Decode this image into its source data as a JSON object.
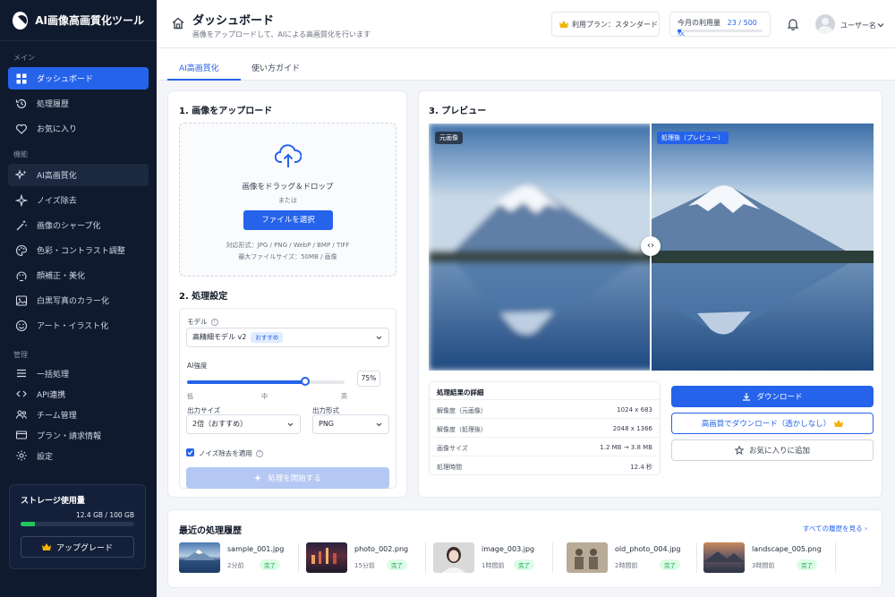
{
  "app": {
    "title": "AI画像高画質化ツール"
  },
  "sidebar": {
    "sections": [
      {
        "heading": "メイン",
        "items": [
          {
            "label": "ダッシュボード",
            "icon": "grid-icon",
            "active": true
          },
          {
            "label": "処理履歴",
            "icon": "history-icon"
          },
          {
            "label": "お気に入り",
            "icon": "heart-icon"
          }
        ]
      },
      {
        "heading": "機能",
        "items": [
          {
            "label": "AI高画質化",
            "icon": "sparkles-icon"
          },
          {
            "label": "ノイズ除去",
            "icon": "sparkle-small-icon"
          },
          {
            "label": "画像のシャープ化",
            "icon": "magic-wand-icon"
          },
          {
            "label": "色彩・コントラスト調整",
            "icon": "palette-icon"
          },
          {
            "label": "顔補正・美化",
            "icon": "face-icon"
          },
          {
            "label": "白黒写真のカラー化",
            "icon": "image-icon"
          },
          {
            "label": "アート・イラスト化",
            "icon": "smile-icon"
          }
        ]
      },
      {
        "heading": "管理",
        "items": [
          {
            "label": "一括処理",
            "icon": "list-icon"
          },
          {
            "label": "API連携",
            "icon": "api-icon"
          },
          {
            "label": "チーム管理",
            "icon": "team-icon"
          },
          {
            "label": "プラン・請求情報",
            "icon": "billing-icon"
          },
          {
            "label": "設定",
            "icon": "gear-icon"
          }
        ]
      }
    ],
    "storage": {
      "title": "ストレージ使用量",
      "value": "12.4 GB / 100 GB",
      "fraction": 0.124,
      "upgrade_label": "アップグレード"
    }
  },
  "header": {
    "title": "ダッシュボード",
    "subtitle": "画像をアップロードして、AIによる高画質化を行います",
    "plan": "利用プラン：スタンダード",
    "usage_label": "今月の利用量",
    "usage_count": "23 / 500 枚",
    "usage_fraction": 0.046,
    "username": "ユーザー名"
  },
  "tabs": [
    "AI高画質化",
    "使い方ガイド"
  ],
  "upload": {
    "title": "1. 画像をアップロード",
    "drop_text": "画像をドラッグ＆ドロップ",
    "or": "または",
    "button": "ファイルを選択",
    "formats": "対応形式：JPG / PNG / WebP / BMP / TIFF",
    "max_size": "最大ファイルサイズ：50MB / 画像"
  },
  "settings": {
    "title": "2. 処理設定",
    "model_label": "モデル",
    "model_value": "高精細モデル v2",
    "model_badge": "おすすめ",
    "strength_label": "AI強度",
    "strength_value": "75%",
    "strength_fraction": 0.75,
    "tick_low": "低",
    "tick_mid": "中",
    "tick_high": "高",
    "size_label": "出力サイズ",
    "size_value": "2倍（おすすめ）",
    "format_label": "出力形式",
    "format_value": "PNG",
    "noise_label": "ノイズ除去を適用",
    "start_button": "処理を開始する"
  },
  "preview": {
    "title": "3. プレビュー",
    "before_label": "元画像",
    "after_label": "処理後（プレビュー）",
    "details_title": "処理結果の詳細",
    "details": [
      {
        "k": "解像度（元画像）",
        "v": "1024 x 683"
      },
      {
        "k": "解像度（処理後）",
        "v": "2048 x 1366"
      },
      {
        "k": "画像サイズ",
        "v": "1.2 MB → 3.8 MB"
      },
      {
        "k": "処理時間",
        "v": "12.4 秒"
      }
    ],
    "download": "ダウンロード",
    "download_hq": "高画質でダウンロード（透かしなし）",
    "favorite": "お気に入りに追加"
  },
  "history": {
    "title": "最近の処理履歴",
    "see_all": "すべての履歴を見る",
    "items": [
      {
        "name": "sample_001.jpg",
        "time": "2分前",
        "status": "完了"
      },
      {
        "name": "photo_002.png",
        "time": "15分前",
        "status": "完了"
      },
      {
        "name": "image_003.jpg",
        "time": "1時間前",
        "status": "完了"
      },
      {
        "name": "old_photo_004.jpg",
        "time": "2時間前",
        "status": "完了"
      },
      {
        "name": "landscape_005.png",
        "time": "3時間前",
        "status": "完了"
      }
    ]
  },
  "colors": {
    "accent": "#2563eb",
    "sidebar_bg": "#0f1a2e",
    "success": "#16a34a"
  }
}
